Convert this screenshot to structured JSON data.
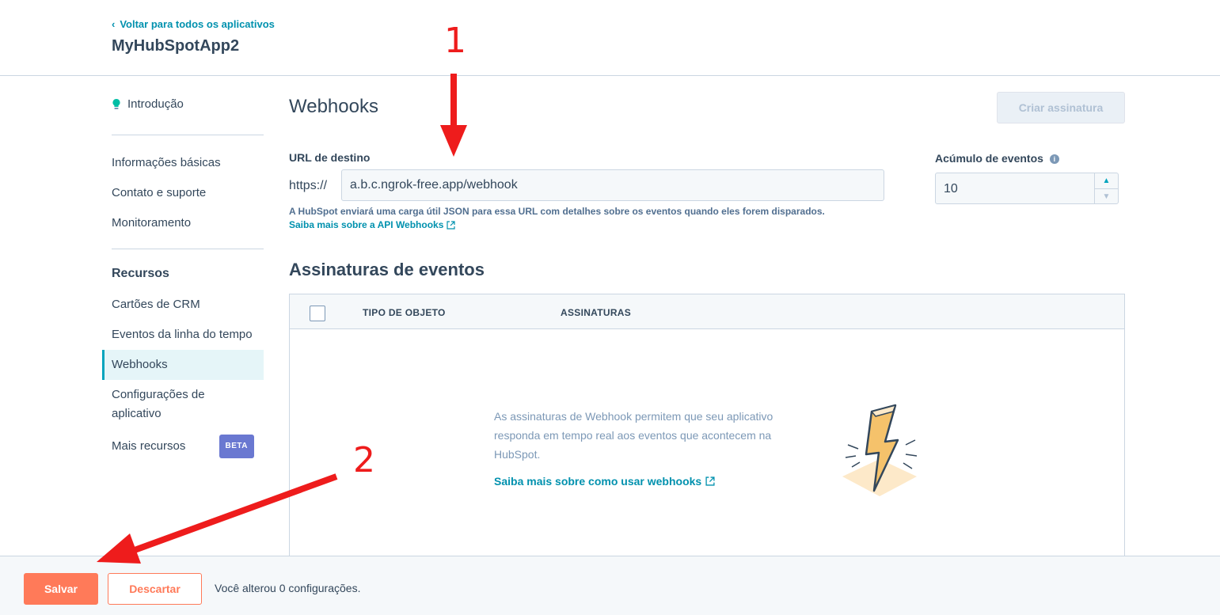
{
  "header": {
    "back_label": "Voltar para todos os aplicativos",
    "app_title": "MyHubSpotApp2"
  },
  "sidebar": {
    "intro": "Introdução",
    "items": [
      {
        "label": "Informações básicas"
      },
      {
        "label": "Contato e suporte"
      },
      {
        "label": "Monitoramento"
      }
    ],
    "resources_heading": "Recursos",
    "resources": [
      {
        "label": "Cartões de CRM"
      },
      {
        "label": "Eventos da linha do tempo"
      },
      {
        "label": "Webhooks",
        "active": true
      },
      {
        "label": "Configurações de aplicativo"
      },
      {
        "label": "Mais recursos",
        "badge": "BETA"
      }
    ]
  },
  "main": {
    "title": "Webhooks",
    "create_button": "Criar assinatura",
    "target_url": {
      "label": "URL de destino",
      "prefix": "https://",
      "value": "a.b.c.ngrok-free.app/webhook",
      "help": "A HubSpot enviará uma carga útil JSON para essa URL com detalhes sobre os eventos quando eles forem disparados.",
      "link": "Saiba mais sobre a API Webhooks"
    },
    "batching": {
      "label": "Acúmulo de eventos",
      "value": "10"
    },
    "subscriptions": {
      "heading": "Assinaturas de eventos",
      "columns": [
        "TIPO DE OBJETO",
        "ASSINATURAS"
      ],
      "empty_text": "As assinaturas de Webhook permitem que seu aplicativo responda em tempo real aos eventos que acontecem na HubSpot.",
      "empty_link": "Saiba mais sobre como usar webhooks"
    }
  },
  "footer": {
    "save": "Salvar",
    "discard": "Descartar",
    "status": "Você alterou 0 configurações."
  },
  "annotations": {
    "arrow1_label": "1",
    "arrow2_label": "2"
  },
  "colors": {
    "accent": "#00a4bd",
    "link": "#0091ae",
    "primary_button": "#ff7a59",
    "annotation": "#ee1c1c",
    "beta_badge": "#6a78d1"
  }
}
